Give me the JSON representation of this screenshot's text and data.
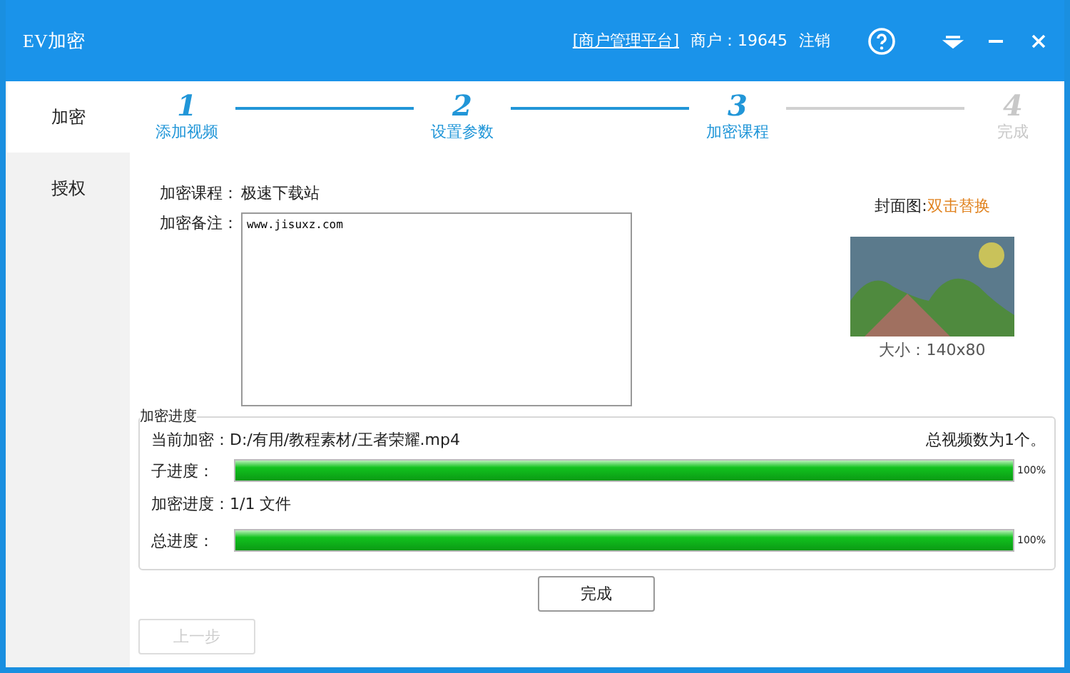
{
  "window": {
    "title": "EV加密",
    "merchant_link": "[商户管理平台]",
    "merchant": "商户：19645",
    "logout": "注销"
  },
  "sidebar": {
    "items": [
      {
        "label": "加密",
        "selected": true
      },
      {
        "label": "授权",
        "selected": false
      }
    ]
  },
  "steps": [
    {
      "number": "1",
      "label": "添加视频",
      "completed": true
    },
    {
      "number": "2",
      "label": "设置参数",
      "completed": true
    },
    {
      "number": "3",
      "label": "加密课程",
      "completed": true
    },
    {
      "number": "4",
      "label": "完成",
      "completed": false
    }
  ],
  "form": {
    "course_label": "加密课程：",
    "course_value": "极速下载站",
    "note_label": "加密备注：",
    "note_value": "www.jisuxz.com",
    "cover_label": "封面图:",
    "cover_action": "双击替换",
    "cover_size": "大小：140x80"
  },
  "progress": {
    "title": "加密进度",
    "current_label": "当前加密：D:/有用/教程素材/王者荣耀.mp4",
    "total_videos": "总视频数为1个。",
    "bars": [
      {
        "label": "子进度：",
        "level": 1,
        "reading": "100%"
      },
      {
        "label": "总进度：",
        "level": 1,
        "reading": "100%"
      }
    ],
    "file_progress": "加密进度：1/1 文件"
  },
  "buttons": [
    {
      "label": "完成",
      "disabled": false
    },
    {
      "label": "上一步",
      "disabled": true
    }
  ]
}
